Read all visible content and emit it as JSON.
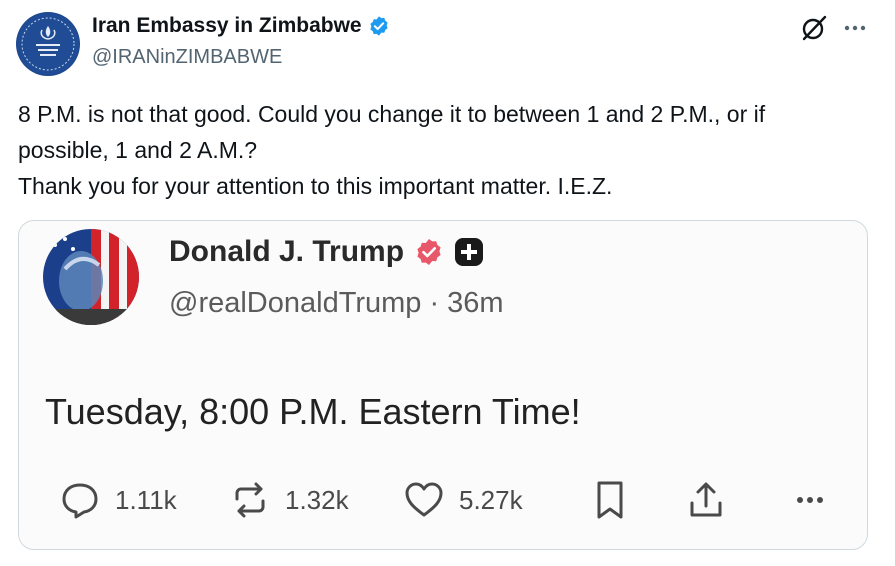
{
  "tweet": {
    "display_name": "Iran Embassy in Zimbabwe",
    "handle": "@IRANinZIMBABWE",
    "text_lines": [
      "8 P.M. is not that good. Could you change it to between 1 and 2 P.M., or if",
      "possible, 1 and 2 A.M.?",
      "Thank you for your attention to this important matter. I.E.Z."
    ],
    "avatar_icon": "embassy-emblem",
    "verified_icon": "verified-badge",
    "accent_color": "#1d9bf0"
  },
  "header_actions": {
    "grok_icon": "grok-icon",
    "more_icon": "more-icon"
  },
  "embedded_post": {
    "display_name": "Donald J. Trump",
    "handle_time": "@realDonaldTrump · 36m",
    "text": "Tuesday, 8:00 P.M. Eastern Time!",
    "badge_color": "#e8586b",
    "actions": [
      {
        "icon": "reply-icon",
        "label": "1.11k"
      },
      {
        "icon": "retruth-icon",
        "label": "1.32k"
      },
      {
        "icon": "like-icon",
        "label": "5.27k"
      },
      {
        "icon": "bookmark-icon",
        "label": ""
      },
      {
        "icon": "share-icon",
        "label": ""
      },
      {
        "icon": "more-icon",
        "label": ""
      }
    ]
  }
}
